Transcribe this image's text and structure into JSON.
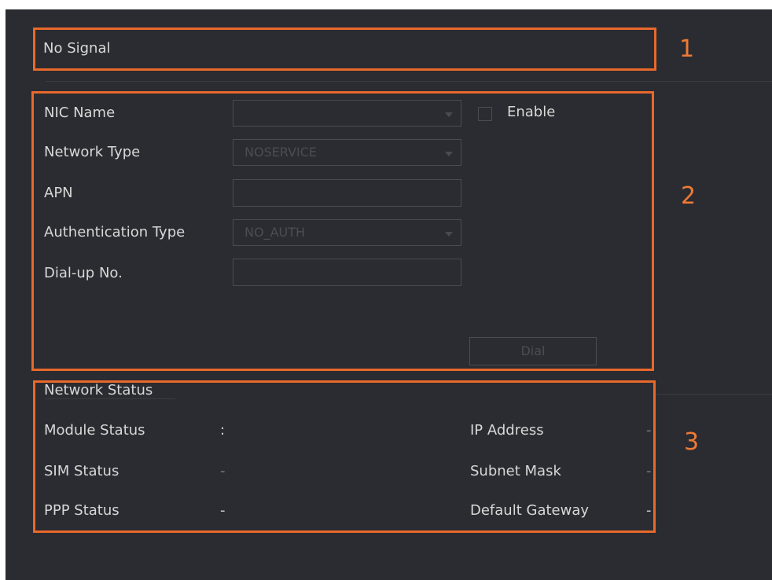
{
  "signal": {
    "text": "No Signal"
  },
  "form": {
    "nic_name_label": "NIC Name",
    "nic_name_value": "",
    "enable_label": "Enable",
    "enable_checked": false,
    "network_type_label": "Network Type",
    "network_type_value": "NOSERVICE",
    "apn_label": "APN",
    "apn_value": "",
    "auth_type_label": "Authentication Type",
    "auth_type_value": "NO_AUTH",
    "dialup_label": "Dial-up No.",
    "dialup_value": "",
    "dial_button": "Dial"
  },
  "status": {
    "title": "Network Status",
    "module_status_label": "Module Status",
    "module_status_value": ":",
    "sim_status_label": "SIM Status",
    "sim_status_value": "-",
    "ppp_status_label": "PPP Status",
    "ppp_status_value": "-",
    "ip_address_label": "IP Address",
    "ip_address_value": "-",
    "subnet_mask_label": "Subnet Mask",
    "subnet_mask_value": "-",
    "default_gateway_label": "Default Gateway",
    "default_gateway_value": "-"
  },
  "callouts": [
    "1",
    "2",
    "3"
  ],
  "colors": {
    "background": "#2b2c31",
    "callout": "#e8692b",
    "text": "#d8d8d8"
  }
}
